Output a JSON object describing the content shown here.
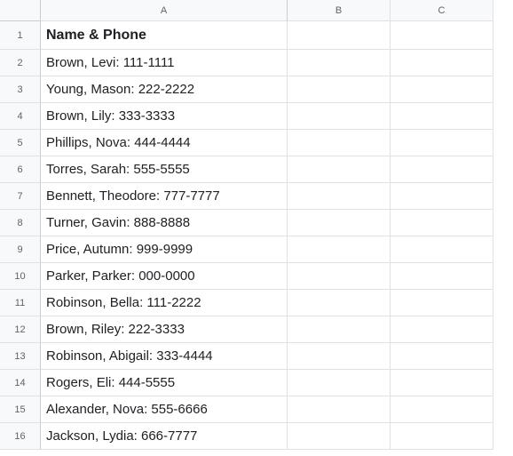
{
  "columns": [
    "A",
    "B",
    "C"
  ],
  "rows": [
    {
      "num": "1",
      "a": "Name & Phone",
      "bold": true
    },
    {
      "num": "2",
      "a": "Brown, Levi: 111-1111"
    },
    {
      "num": "3",
      "a": "Young, Mason: 222-2222"
    },
    {
      "num": "4",
      "a": "Brown, Lily: 333-3333"
    },
    {
      "num": "5",
      "a": "Phillips, Nova: 444-4444"
    },
    {
      "num": "6",
      "a": "Torres, Sarah: 555-5555"
    },
    {
      "num": "7",
      "a": "Bennett, Theodore: 777-7777"
    },
    {
      "num": "8",
      "a": "Turner, Gavin: 888-8888"
    },
    {
      "num": "9",
      "a": "Price, Autumn: 999-9999"
    },
    {
      "num": "10",
      "a": "Parker, Parker: 000-0000"
    },
    {
      "num": "11",
      "a": "Robinson, Bella: 111-2222"
    },
    {
      "num": "12",
      "a": "Brown, Riley: 222-3333"
    },
    {
      "num": "13",
      "a": "Robinson, Abigail: 333-4444"
    },
    {
      "num": "14",
      "a": "Rogers, Eli: 444-5555"
    },
    {
      "num": "15",
      "a": "Alexander, Nova: 555-6666"
    },
    {
      "num": "16",
      "a": "Jackson, Lydia: 666-7777"
    }
  ]
}
